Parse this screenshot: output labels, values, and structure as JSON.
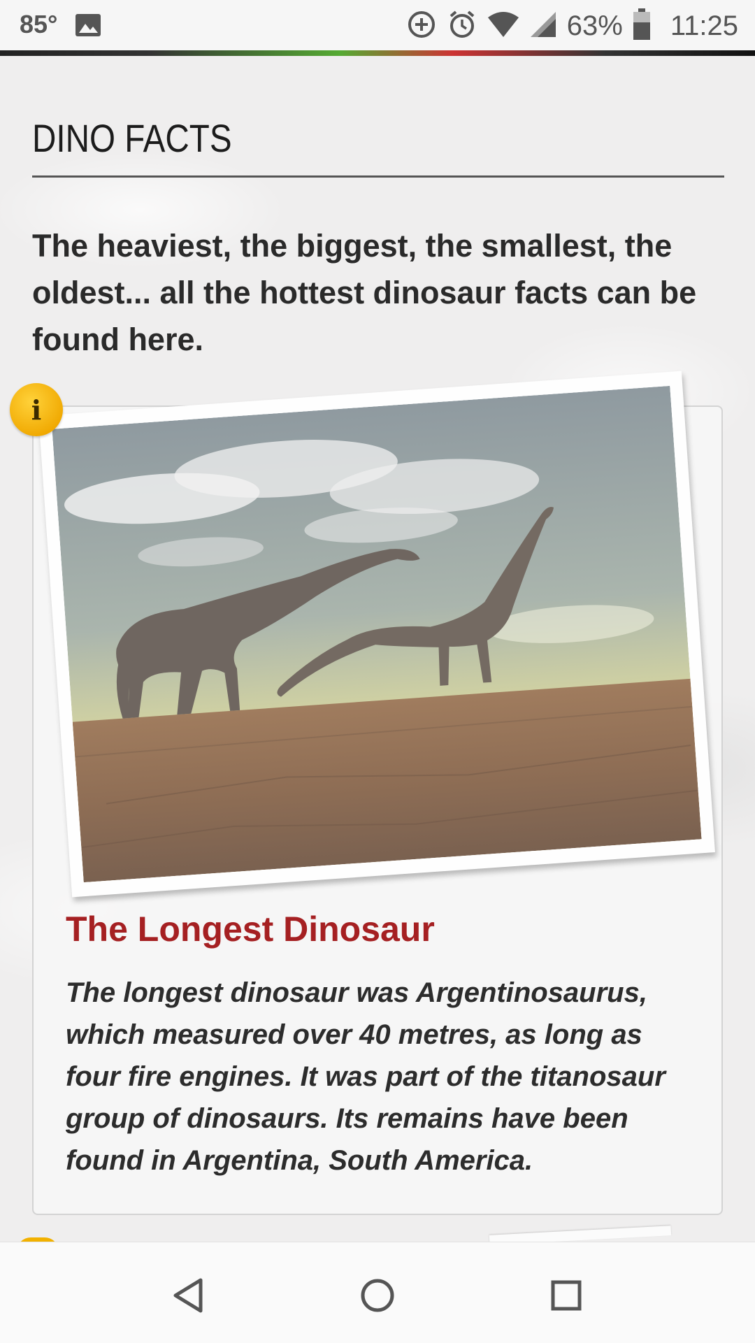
{
  "status_bar": {
    "temperature": "85°",
    "battery": "63%",
    "time": "11:25"
  },
  "page": {
    "section_title": "DINO FACTS",
    "intro": "The heaviest, the biggest, the smallest, the oldest... all the hottest dinosaur facts can be found here."
  },
  "fact_card": {
    "info_badge": "i",
    "title": "The Longest Dinosaur",
    "body": "The longest dinosaur was Argentinosaurus, which measured over 40 metres, as long as four fire engines. It was part of the titanosaur group of dinosaurs. Its remains have been found in Argentina, South America."
  },
  "nav": {
    "back_icon": "back-triangle-icon",
    "home_icon": "home-circle-icon",
    "recents_icon": "recents-square-icon"
  },
  "colors": {
    "accent_title": "#a52022",
    "badge": "#f0a800"
  }
}
